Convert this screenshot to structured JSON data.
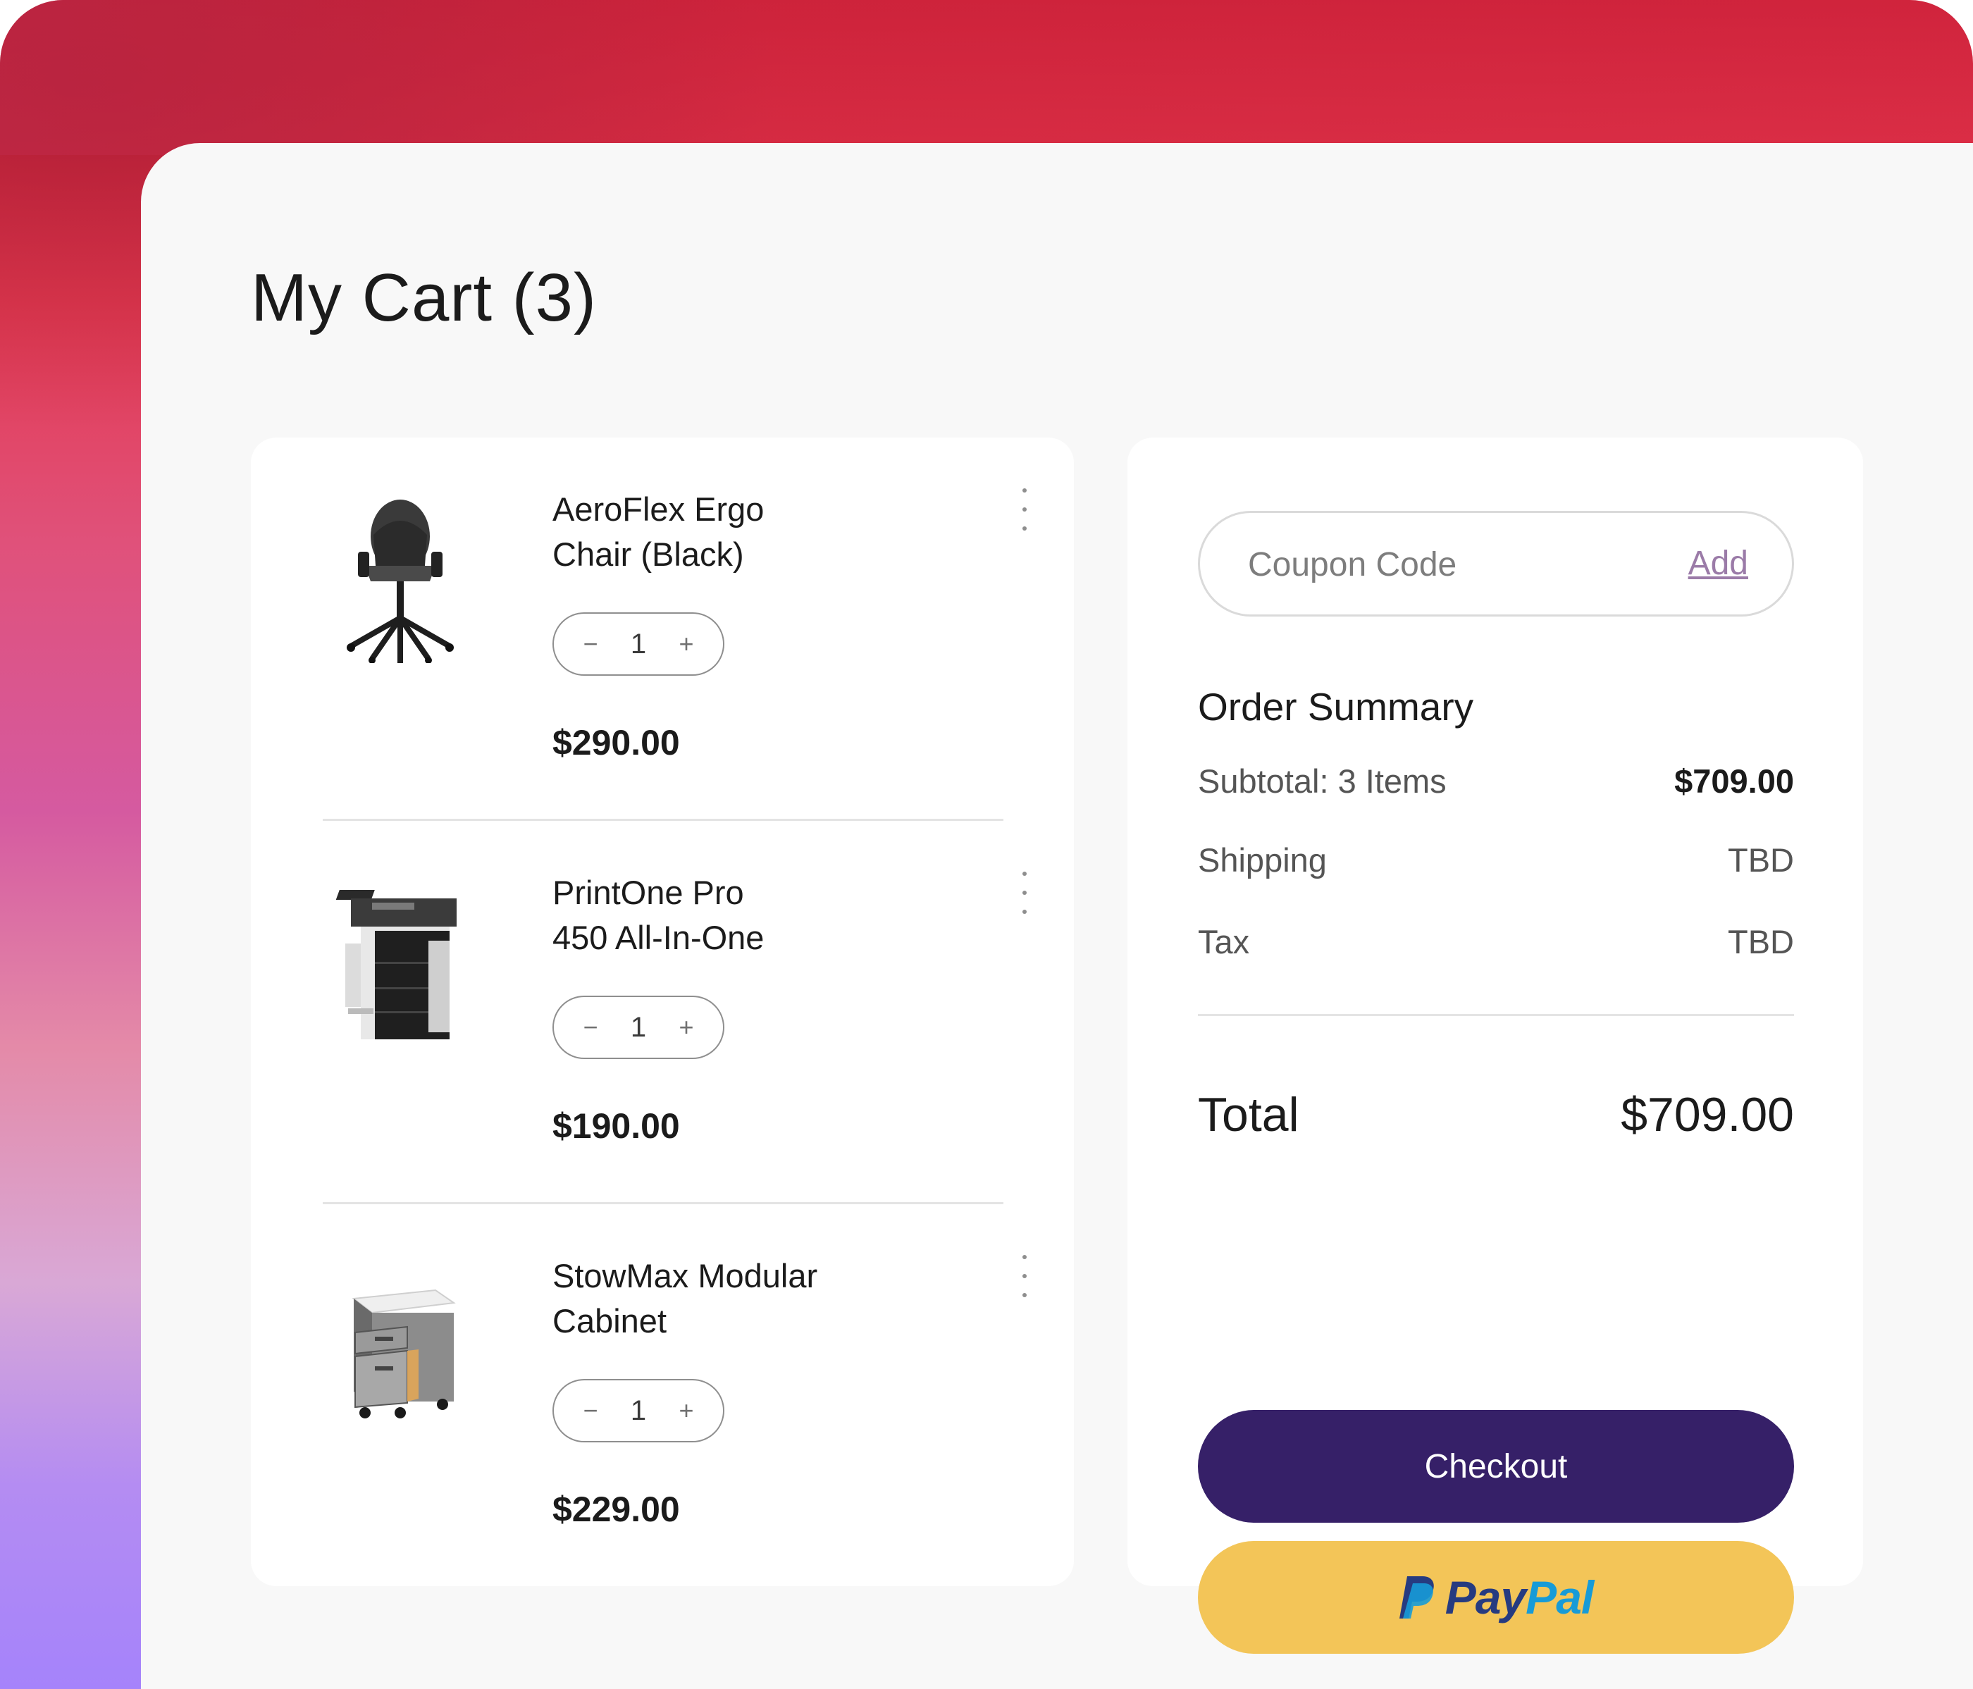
{
  "page": {
    "title": "My Cart (3)"
  },
  "cart": {
    "items": [
      {
        "name_line1": "AeroFlex Ergo",
        "name_line2": "Chair (Black)",
        "quantity": "1",
        "price": "$290.00",
        "image": "office-chair-image"
      },
      {
        "name_line1": "PrintOne Pro",
        "name_line2": "450 All-In-One",
        "quantity": "1",
        "price": "$190.00",
        "image": "printer-image"
      },
      {
        "name_line1": "StowMax Modular",
        "name_line2": "Cabinet",
        "quantity": "1",
        "price": "$229.00",
        "image": "cabinet-image"
      }
    ],
    "decrement_symbol": "−",
    "increment_symbol": "+"
  },
  "summary": {
    "coupon_placeholder": "Coupon Code",
    "coupon_add_label": "Add",
    "heading": "Order Summary",
    "subtotal_label": "Subtotal: 3 Items",
    "subtotal_value": "$709.00",
    "shipping_label": "Shipping",
    "shipping_value": "TBD",
    "tax_label": "Tax",
    "tax_value": "TBD",
    "total_label": "Total",
    "total_value": "$709.00",
    "checkout_label": "Checkout",
    "paypal_label_a": "Pay",
    "paypal_label_b": "Pal"
  },
  "colors": {
    "checkout_bg": "#362068",
    "paypal_bg": "#f3c558",
    "paypal_dark": "#263b80",
    "paypal_light": "#179bd7",
    "coupon_link": "#9b7ba8"
  }
}
